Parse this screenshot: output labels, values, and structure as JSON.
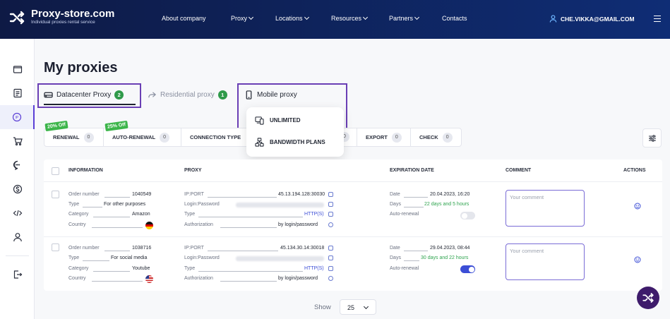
{
  "header": {
    "brand": "Proxy-store.com",
    "tagline": "Individual proxies rental service",
    "nav": [
      "About company",
      "Proxy",
      "Locations",
      "Resources",
      "Partners",
      "Contacts"
    ],
    "user_email": "CHE.VIKKA@GMAIL.COM"
  },
  "sidebar": {
    "items": [
      "wallet-icon",
      "list-icon",
      "ip-icon",
      "cart-icon",
      "chat-icon",
      "dollar-icon",
      "code-icon",
      "user-icon",
      "logout-icon"
    ],
    "active": "ip-icon"
  },
  "page": {
    "title": "My proxies"
  },
  "tabs": [
    {
      "label": "Datacenter Proxy",
      "count": "2"
    },
    {
      "label": "Residential proxy",
      "count": "1"
    },
    {
      "label": "Mobile proxy"
    }
  ],
  "dropdown": {
    "items": [
      "UNLIMITED",
      "BANDWIDTH PLANS"
    ]
  },
  "actions": {
    "promo_renewal": "20% Off",
    "promo_autorenewal": "25% Off",
    "buttons": [
      {
        "label": "RENEWAL",
        "count": "0"
      },
      {
        "label": "AUTO-RENEWAL",
        "count": "0"
      },
      {
        "label": "CONNECTION TYPE",
        "count": "0"
      },
      {
        "label": "EXPORT",
        "count": "0"
      },
      {
        "label": "CHECK",
        "count": "0"
      }
    ]
  },
  "table": {
    "headers": [
      "INFORMATION",
      "PROXY",
      "EXPIRATION DATE",
      "COMMENT",
      "ACTIONS"
    ],
    "labels": {
      "order": "Order number",
      "type": "Type",
      "category": "Category",
      "country": "Country",
      "ipport": "IP:PORT",
      "login": "Login:Password",
      "ptype": "Type",
      "auth": "Authorization",
      "date": "Date",
      "days": "Days",
      "autorenew": "Auto-renewal"
    },
    "comment_placeholder": "Your comment",
    "rows": [
      {
        "order": "1040549",
        "type": "For other purposes",
        "category": "Amazon",
        "country_flag": "de",
        "ipport": "45.13.194.128:30030",
        "proxy_type": "HTTP(S)",
        "auth": "by login/password",
        "date": "20.04.2023, 16:20",
        "days": "22 days and 5 hours",
        "auto_renewal": false
      },
      {
        "order": "1038716",
        "type": "For social media",
        "category": "Youtube",
        "country_flag": "us",
        "ipport": "45.134.30.14:30018",
        "proxy_type": "HTTP(S)",
        "auth": "by login/password",
        "date": "29.04.2023, 08:44",
        "days": "30 days and 22 hours",
        "auto_renewal": true
      }
    ]
  },
  "pagination": {
    "show_label": "Show",
    "per_page": "25"
  },
  "colors": {
    "header": "#0f2d75",
    "accent": "#5b3fd6",
    "green": "#2fa44f",
    "highlight": "#6a3fb5"
  }
}
